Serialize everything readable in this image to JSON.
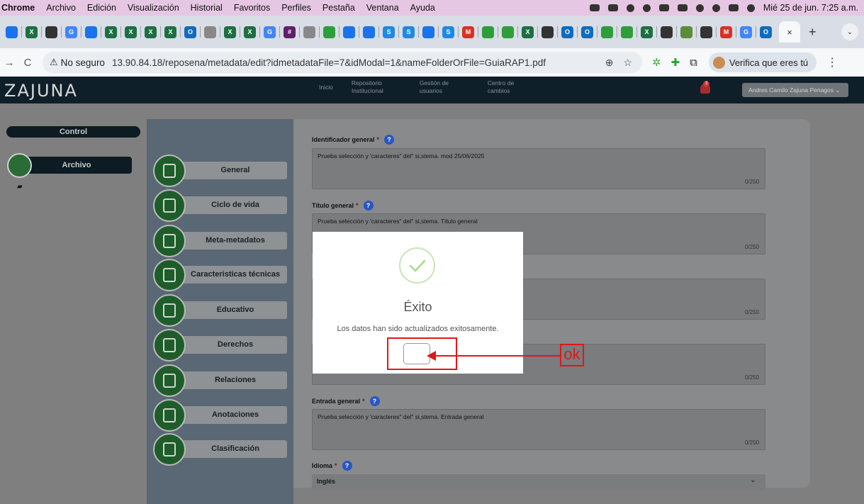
{
  "menubar": {
    "app": "Chrome",
    "items": [
      "Archivo",
      "Edición",
      "Visualización",
      "Historial",
      "Favoritos",
      "Perfiles",
      "Pestaña",
      "Ventana",
      "Ayuda"
    ],
    "datetime": "Mié 25 de jun.  7:25 a.m."
  },
  "tabstrip": {
    "close_label": "×",
    "new_tab_label": "+",
    "tab_menu_label": "⌄",
    "pinned_icons": [
      {
        "icon": "cloud-icon",
        "color": "#1a73e8"
      },
      {
        "icon": "excel-icon",
        "color": "#1d6f42"
      },
      {
        "icon": "target-icon",
        "color": "#333333"
      },
      {
        "icon": "google-icon",
        "color": "#4285f4"
      },
      {
        "icon": "cloud-icon",
        "color": "#1a73e8"
      },
      {
        "icon": "excel-icon",
        "color": "#1d6f42"
      },
      {
        "icon": "excel-icon",
        "color": "#1d6f42"
      },
      {
        "icon": "excel-icon",
        "color": "#1d6f42"
      },
      {
        "icon": "excel-icon",
        "color": "#1d6f42"
      },
      {
        "icon": "outlook-icon",
        "color": "#0f6cbd"
      },
      {
        "icon": "chrome-icon",
        "color": "#888888"
      },
      {
        "icon": "excel-icon",
        "color": "#1d6f42"
      },
      {
        "icon": "excel-icon",
        "color": "#1d6f42"
      },
      {
        "icon": "google-icon",
        "color": "#4285f4"
      },
      {
        "icon": "slack-icon",
        "color": "#611f69"
      },
      {
        "icon": "chrome-icon",
        "color": "#888888"
      },
      {
        "icon": "green-circle-icon",
        "color": "#2e9d3a"
      },
      {
        "icon": "cloud-icon",
        "color": "#1a73e8"
      },
      {
        "icon": "cloud-icon",
        "color": "#1a73e8"
      },
      {
        "icon": "s-icon",
        "color": "#1e88e5"
      },
      {
        "icon": "s-icon",
        "color": "#1e88e5"
      },
      {
        "icon": "cloud-icon",
        "color": "#1a73e8"
      },
      {
        "icon": "s-icon",
        "color": "#1e88e5"
      },
      {
        "icon": "gmail-icon",
        "color": "#d93025"
      },
      {
        "icon": "green-circle-icon",
        "color": "#2e9d3a"
      },
      {
        "icon": "green-circle-icon",
        "color": "#2e9d3a"
      },
      {
        "icon": "excel-icon",
        "color": "#1d6f42"
      },
      {
        "icon": "target-icon",
        "color": "#333333"
      },
      {
        "icon": "outlook-icon",
        "color": "#0f6cbd"
      },
      {
        "icon": "outlook-icon",
        "color": "#0f6cbd"
      },
      {
        "icon": "green-circle-icon",
        "color": "#2e9d3a"
      },
      {
        "icon": "green-circle-icon",
        "color": "#2e9d3a"
      },
      {
        "icon": "excel-icon",
        "color": "#1d6f42"
      },
      {
        "icon": "github-icon",
        "color": "#333333"
      },
      {
        "icon": "image-icon",
        "color": "#5b8c3a"
      },
      {
        "icon": "target-icon",
        "color": "#333333"
      },
      {
        "icon": "gmail-icon",
        "color": "#d93025"
      },
      {
        "icon": "google-icon",
        "color": "#4285f4"
      },
      {
        "icon": "outlook-icon",
        "color": "#0f6cbd"
      }
    ]
  },
  "addressbar": {
    "back": "←",
    "forward": "→",
    "reload": "C",
    "insecure_label": "No seguro",
    "url": "13.90.84.18/reposena/metadata/edit?idmetadataFile=7&idModal=1&nameFolderOrFile=GuiaRAP1.pdf",
    "verify_label": "Verifica que eres tú",
    "zoom_icon": "⊕",
    "star_icon": "☆",
    "kebab": "⋮"
  },
  "app": {
    "logo": "ZAJUNA",
    "topnav": [
      {
        "label": "Inicio"
      },
      {
        "label": "Repositorio Institucional"
      },
      {
        "label": "Gestión de usuarios"
      },
      {
        "label": "Centro de cambios"
      }
    ],
    "notifications_count": "3",
    "user_name": "Andres Camilo Zajuna Penagos",
    "control_label": "Control",
    "archivo_label": "Archivo",
    "sections": [
      {
        "label": "General",
        "icon": "document-icon"
      },
      {
        "label": "Ciclo de vida",
        "icon": "cycle-icon"
      },
      {
        "label": "Meta-metadatos",
        "icon": "certificate-icon"
      },
      {
        "label": "Caracteristicas técnicas",
        "icon": "settings-document-icon"
      },
      {
        "label": "Educativo",
        "icon": "graduation-icon"
      },
      {
        "label": "Derechos",
        "icon": "scales-icon"
      },
      {
        "label": "Relaciones",
        "icon": "handshake-icon"
      },
      {
        "label": "Anotaciones",
        "icon": "notes-icon"
      },
      {
        "label": "Clasificación",
        "icon": "trophy-icon"
      }
    ],
    "fields": {
      "identificador": {
        "label": "Identificador general",
        "value": "Prueba selección y 'caracteres\" del\" si,stema. mod 25/06/2025",
        "count": "0/250"
      },
      "titulo": {
        "label": "Título general",
        "value": "Prueba selección y 'caracteres\" del\" si,stema. Título general",
        "count": "0/250"
      },
      "field3": {
        "count": "0/250"
      },
      "field4": {
        "count": "0/250"
      },
      "entrada": {
        "label": "Entrada general",
        "value": "Prueba selección y 'caracteres\" del\" si,stema. Entrada general",
        "count": "0/250"
      },
      "idioma": {
        "label": "Idioma",
        "value": "Inglés"
      }
    },
    "required_marker": "*",
    "help_marker": "?"
  },
  "modal": {
    "title": "Éxito",
    "message": "Los datos han sido actualizados exitosamente."
  },
  "annotation": {
    "label": "ok",
    "color": "#e01818"
  }
}
